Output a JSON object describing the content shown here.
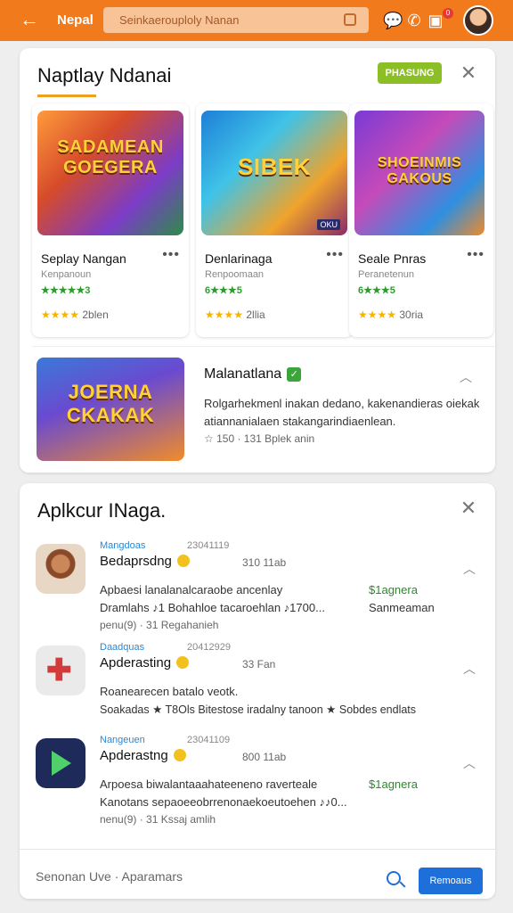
{
  "topbar": {
    "title": "Nepal",
    "search_placeholder": "Seinkaerouploly Nanan",
    "badge": "0"
  },
  "card1": {
    "title": "Naptlay Ndanai",
    "pill": "PHASUNG",
    "tiles": [
      {
        "art_text": "SADAMEAN GOEGERA",
        "name": "Seplay Nangan",
        "dev": "Kenpanoun",
        "tag": "★★★★★3",
        "rating_stars": "★★★★",
        "rating": "2blen"
      },
      {
        "art_text": "SIBEK",
        "name": "Denlarinaga",
        "dev": "Renpoomaan",
        "tag": "6★★★5",
        "rating_stars": "★★★★",
        "rating": "2llia",
        "badge": "OKU"
      },
      {
        "art_text": "SHOEINMIS GAKOUS",
        "name": "Seale Pnras",
        "dev": "Peranetenun",
        "tag": "6★★★5",
        "rating_stars": "★★★★",
        "rating": "30ria"
      }
    ],
    "featured": {
      "art_text": "JOERNA CKAKAK",
      "title": "Malanatlana",
      "desc": "Rolgarhekmenl inakan dedano, kakenandieras oiekak atiannanialaen stakangarindiaenlean.",
      "meta": "☆ 150 · 131 Bplek anin"
    }
  },
  "card2": {
    "title": "Aplkcur INaga.",
    "items": [
      {
        "cat": "Mangdoas",
        "date": "23041119",
        "name": "Bedaprsdng",
        "info": "310 11ab",
        "line1": "Apbaesi lanalanalcaraobe ancenlay",
        "side1": "$1agnera",
        "line2": "Dramlahs ♪1 Bohahloe tacaroehlan ♪1700...",
        "side2": "Sanmeaman",
        "small": "penu(9)  ·  31   Regahanieh"
      },
      {
        "cat": "Daadquas",
        "date": "20412929",
        "name": "Apderasting",
        "info": "33 Fan",
        "line1": "Roanearecen batalo veotk.",
        "line2": "Soakadas ★ T8Ols Bitestose iradalny tanoon ★ Sobdes endlats"
      },
      {
        "cat": "Nangeuen",
        "date": "23041109",
        "name": "Apderastng",
        "info": "800 11ab",
        "line1": "Arpoesa biwalantaaahateeneno raverteale",
        "side1": "$1agnera",
        "line2": "Kanotans sepaoeeobrrenonaekoeutoehen ♪♪0...",
        "small": "nenu(9)  ·  31   Kssaj amlih"
      }
    ],
    "footer_text": "Senonan Uve  ·  Aparamars",
    "footer_button": "Remoaus"
  }
}
